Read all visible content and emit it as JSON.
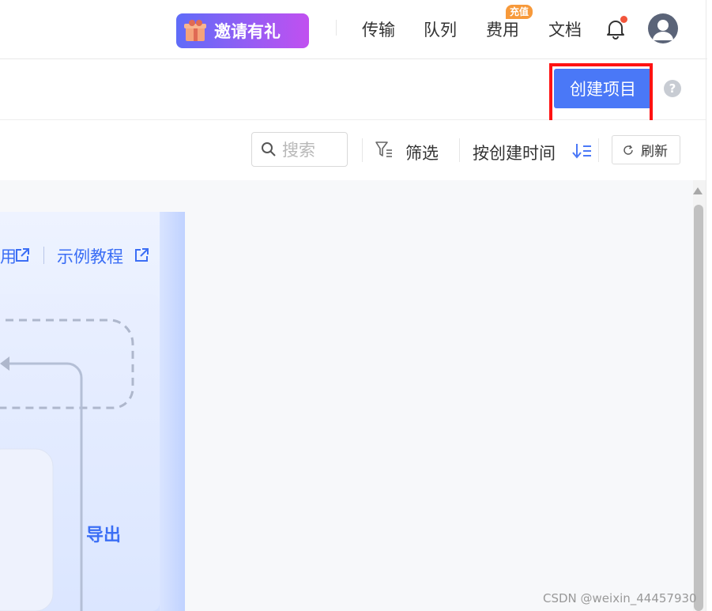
{
  "header": {
    "invite_label": "邀请有礼",
    "nav": [
      "传输",
      "队列",
      "费用",
      "文档"
    ],
    "recharge_badge": "充值",
    "colors": {
      "invite_gradient_start": "#5f6cf8",
      "invite_gradient_end": "#c150f0",
      "badge": "#f7993a",
      "notify_dot": "#f2553b"
    }
  },
  "toolbar": {
    "create_project_label": "创建项目",
    "help_symbol": "?",
    "search_placeholder": "搜索",
    "filter_label": "筛选",
    "sort_label": "按创建时间",
    "refresh_label": "刷新",
    "accent": "#4a78f7"
  },
  "panel": {
    "links": [
      "用",
      "示例教程"
    ],
    "export_label": "导出"
  },
  "watermark": "CSDN @weixin_44457930"
}
